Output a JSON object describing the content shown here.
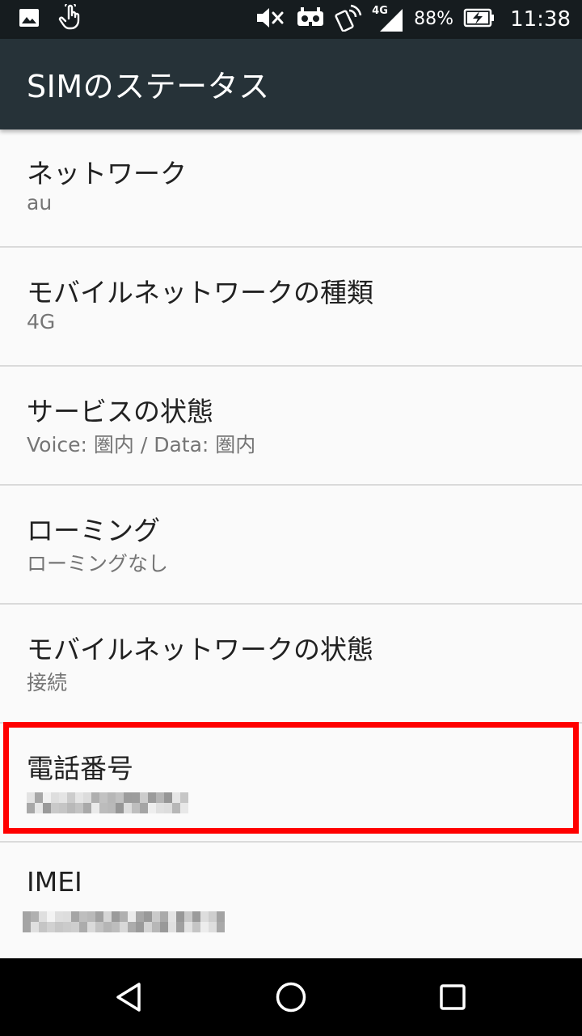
{
  "status_bar": {
    "battery_percent": "88%",
    "network_type": "4G",
    "time": "11:38",
    "icons_left": [
      "image-icon",
      "touch-hand-icon"
    ],
    "icons_right": [
      "mute-icon",
      "vr-icon",
      "nfc-icon",
      "signal-4g-icon",
      "battery-charging-icon"
    ]
  },
  "app_bar": {
    "title": "SIMのステータス"
  },
  "rows": [
    {
      "label": "ネットワーク",
      "value": "au"
    },
    {
      "label": "モバイルネットワークの種類",
      "value": "4G"
    },
    {
      "label": "サービスの状態",
      "value": "Voice: 圏内 / Data: 圏内"
    },
    {
      "label": "ローミング",
      "value": "ローミングなし"
    },
    {
      "label": "モバイルネットワークの状態",
      "value": "接続"
    },
    {
      "label": "電話番号",
      "value_pixelated": true
    },
    {
      "label": "IMEI",
      "value_pixelated": true
    }
  ],
  "colors": {
    "status_bar_bg": "#161c1f",
    "app_bar_bg": "#263238",
    "list_bg": "#fafafa",
    "highlight": "#ff0000",
    "nav_bar_bg": "#000000"
  },
  "nav_bar": {
    "buttons": [
      "back-icon",
      "home-icon",
      "recents-icon"
    ]
  }
}
